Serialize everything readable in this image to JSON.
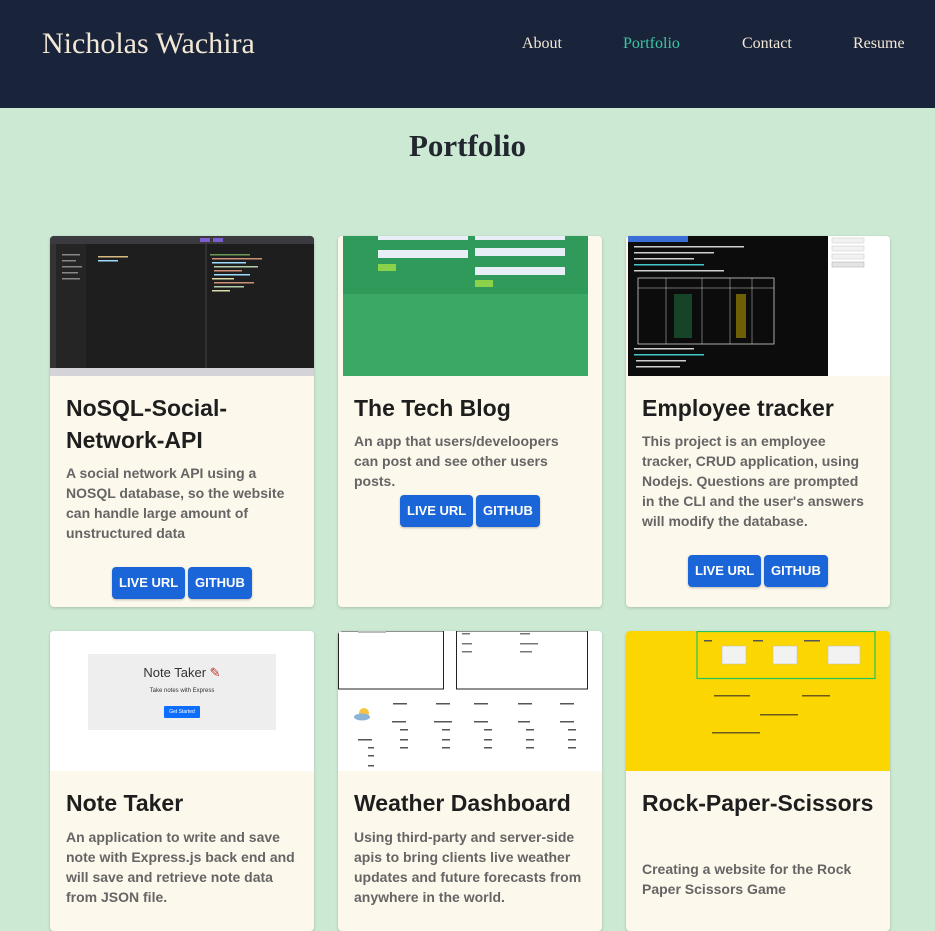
{
  "header": {
    "brand": "Nicholas Wachira",
    "nav": [
      {
        "label": "About"
      },
      {
        "label": "Portfolio",
        "active": true
      },
      {
        "label": "Contact"
      },
      {
        "label": "Resume"
      }
    ]
  },
  "page_title": "Portfolio",
  "projects": [
    {
      "title": "NoSQL-Social-Network-API",
      "description": "A social network API using a NOSQL database, so the website can handle large amount of unstructured data",
      "live_label": "LIVE URL",
      "github_label": "GITHUB"
    },
    {
      "title": "The Tech Blog",
      "description": "An app that users/develoopers can post and see other users posts.",
      "live_label": "LIVE URL",
      "github_label": "GITHUB"
    },
    {
      "title": "Employee tracker",
      "description": "This project is an employee tracker, CRUD application, using Nodejs. Questions are prompted in the CLI and the user's answers will modify the database.",
      "live_label": "LIVE URL",
      "github_label": "GITHUB"
    },
    {
      "title": "Note Taker",
      "description": "An application to write and save note with Express.js back end and will save and retrieve note data from JSON file.",
      "thumb_title": "Note Taker",
      "thumb_subtitle": "Take notes with Express",
      "thumb_button": "Get Started"
    },
    {
      "title": "Weather Dashboard",
      "description": "Using third-party and server-side apis to bring clients live weather updates and future forecasts from anywhere in the world."
    },
    {
      "title": "Rock-Paper-Scissors",
      "description": "Creating a website for the Rock Paper Scissors Game"
    }
  ],
  "colors": {
    "header_bg": "#19243a",
    "page_bg": "#cce9d4",
    "nav_active": "#3cc7a4",
    "button": "#1a66d9",
    "card_bg": "#fdf8ec"
  }
}
